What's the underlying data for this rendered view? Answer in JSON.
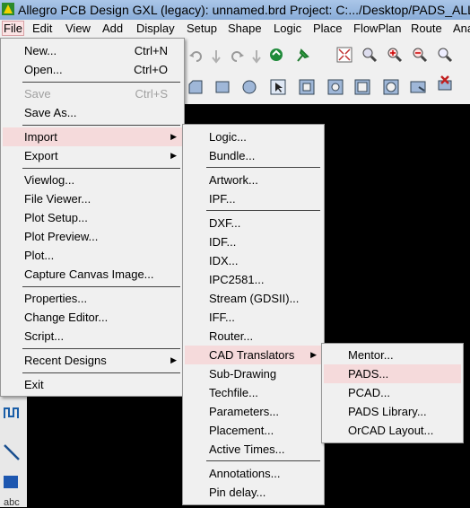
{
  "window": {
    "title": "Allegro PCB Design GXL (legacy): unnamed.brd  Project: C:.../Desktop/PADS_ALLEGRO"
  },
  "menubar": [
    "File",
    "Edit",
    "View",
    "Add",
    "Display",
    "Setup",
    "Shape",
    "Logic",
    "Place",
    "FlowPlan",
    "Route",
    "Ana"
  ],
  "file_menu": {
    "new": "New...",
    "new_acc": "Ctrl+N",
    "open": "Open...",
    "open_acc": "Ctrl+O",
    "save": "Save",
    "save_acc": "Ctrl+S",
    "save_as": "Save As...",
    "import": "Import",
    "export": "Export",
    "viewlog": "Viewlog...",
    "file_viewer": "File Viewer...",
    "plot_setup": "Plot Setup...",
    "plot_preview": "Plot Preview...",
    "plot": "Plot...",
    "capture": "Capture Canvas Image...",
    "properties": "Properties...",
    "change_editor": "Change Editor...",
    "script": "Script...",
    "recent": "Recent Designs",
    "exit": "Exit"
  },
  "import_menu": {
    "logic": "Logic...",
    "bundle": "Bundle...",
    "artwork": "Artwork...",
    "ipf": "IPF...",
    "dxf": "DXF...",
    "idf": "IDF...",
    "idx": "IDX...",
    "ipc2581": "IPC2581...",
    "stream": "Stream (GDSII)...",
    "iff": "IFF...",
    "router": "Router...",
    "cad": "CAD Translators",
    "subdrawing": "Sub-Drawing",
    "techfile": "Techfile...",
    "parameters": "Parameters...",
    "placement": "Placement...",
    "active_times": "Active Times...",
    "annotations": "Annotations...",
    "pin_delay": "Pin delay..."
  },
  "cad_menu": {
    "mentor": "Mentor...",
    "pads": "PADS...",
    "pcad": "PCAD...",
    "pads_library": "PADS Library...",
    "orcad_layout": "OrCAD Layout..."
  }
}
